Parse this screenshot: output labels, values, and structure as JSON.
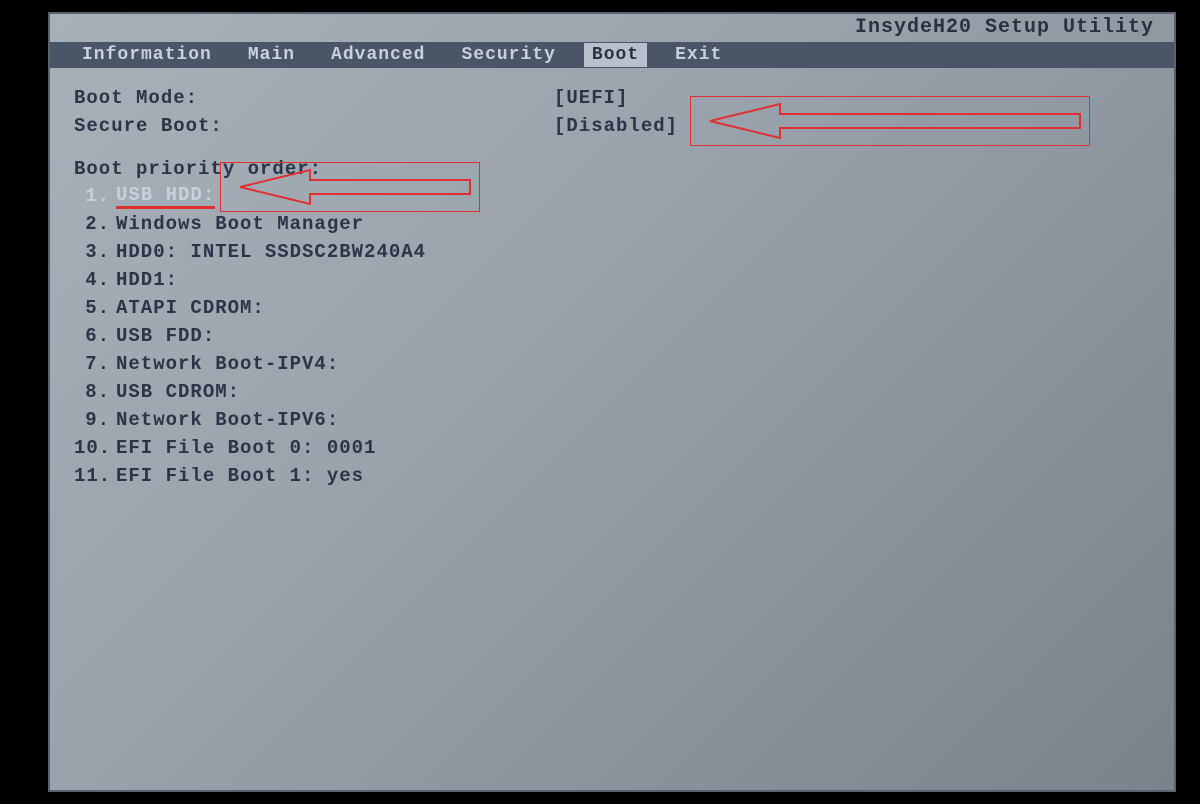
{
  "utility_title": "InsydeH20 Setup Utility",
  "menu": {
    "items": [
      {
        "label": "Information"
      },
      {
        "label": "Main"
      },
      {
        "label": "Advanced"
      },
      {
        "label": "Security"
      },
      {
        "label": "Boot",
        "active": true
      },
      {
        "label": "Exit"
      }
    ]
  },
  "settings": {
    "boot_mode_label": "Boot Mode:",
    "boot_mode_value": "[UEFI]",
    "secure_boot_label": "Secure Boot:",
    "secure_boot_value": "[Disabled]"
  },
  "boot_priority": {
    "header": "Boot priority order:",
    "items": [
      {
        "num": "1.",
        "label": "USB HDD:",
        "selected": true
      },
      {
        "num": "2.",
        "label": "Windows Boot Manager"
      },
      {
        "num": "3.",
        "label": "HDD0: INTEL SSDSC2BW240A4"
      },
      {
        "num": "4.",
        "label": "HDD1:"
      },
      {
        "num": "5.",
        "label": "ATAPI CDROM:"
      },
      {
        "num": "6.",
        "label": "USB FDD:"
      },
      {
        "num": "7.",
        "label": "Network Boot-IPV4:"
      },
      {
        "num": "8.",
        "label": "USB CDROM:"
      },
      {
        "num": "9.",
        "label": "Network Boot-IPV6:"
      },
      {
        "num": "10.",
        "label": "EFI File Boot 0: 0001"
      },
      {
        "num": "11.",
        "label": "EFI File Boot 1: yes"
      }
    ]
  }
}
